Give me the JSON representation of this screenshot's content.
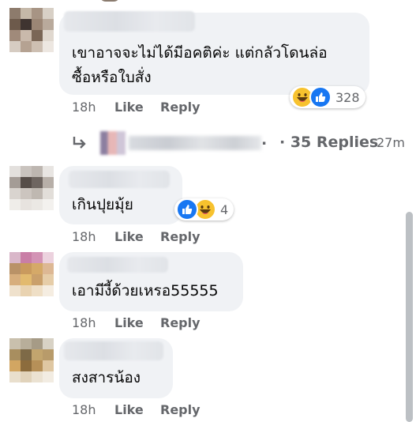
{
  "comments": [
    {
      "text_lines": [
        "เขาอาจจะไม่ได้มีอคติค่ะ แต่กลัวโดนล่อ",
        "ซื้อหรือใบสั่ง"
      ],
      "time": "18h",
      "like": "Like",
      "reply": "Reply",
      "reactions": [
        "haha",
        "like"
      ],
      "reaction_count": "328"
    },
    {
      "text_lines": [
        "เกินปุยมุ้ย"
      ],
      "time": "18h",
      "like": "Like",
      "reply": "Reply",
      "reactions": [
        "like",
        "haha"
      ],
      "reaction_count": "4"
    },
    {
      "text_lines": [
        "เอามีงี้ด้วยเหรอ55555"
      ],
      "time": "18h",
      "like": "Like",
      "reply": "Reply"
    },
    {
      "text_lines": [
        "สงสารน้อง"
      ],
      "time": "18h",
      "like": "Like",
      "reply": "Reply"
    }
  ],
  "replies_link": {
    "dot": ".",
    "label": "· 35 Replies",
    "time": "27m"
  },
  "colors": {
    "bubble": "#f0f2f5",
    "meta": "#65676b",
    "like_blue": "#1877f2",
    "haha_yellow": "#f7c22e",
    "scrollbar": "#bcc0c4"
  },
  "icons": [
    "reply-arrow-icon",
    "haha-reaction-icon",
    "like-reaction-icon"
  ]
}
